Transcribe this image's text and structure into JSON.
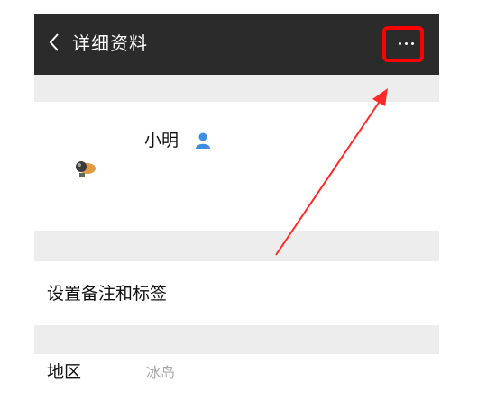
{
  "header": {
    "title": "详细资料",
    "back_icon": "chevron-left-icon",
    "more_icon": "more-dots-icon"
  },
  "profile": {
    "name": "小明",
    "gender_icon": "male-user-icon",
    "avatar_icon": "avatar-icon"
  },
  "rows": {
    "remark_label": "设置备注和标签",
    "region_label": "地区",
    "region_value": "冰岛"
  },
  "colors": {
    "header_bg": "#2b2b2b",
    "section_gap": "#ededed",
    "annotation_red": "#ff0000",
    "gender_blue": "#3d8ee0",
    "secondary_text": "#a8a8a8"
  }
}
